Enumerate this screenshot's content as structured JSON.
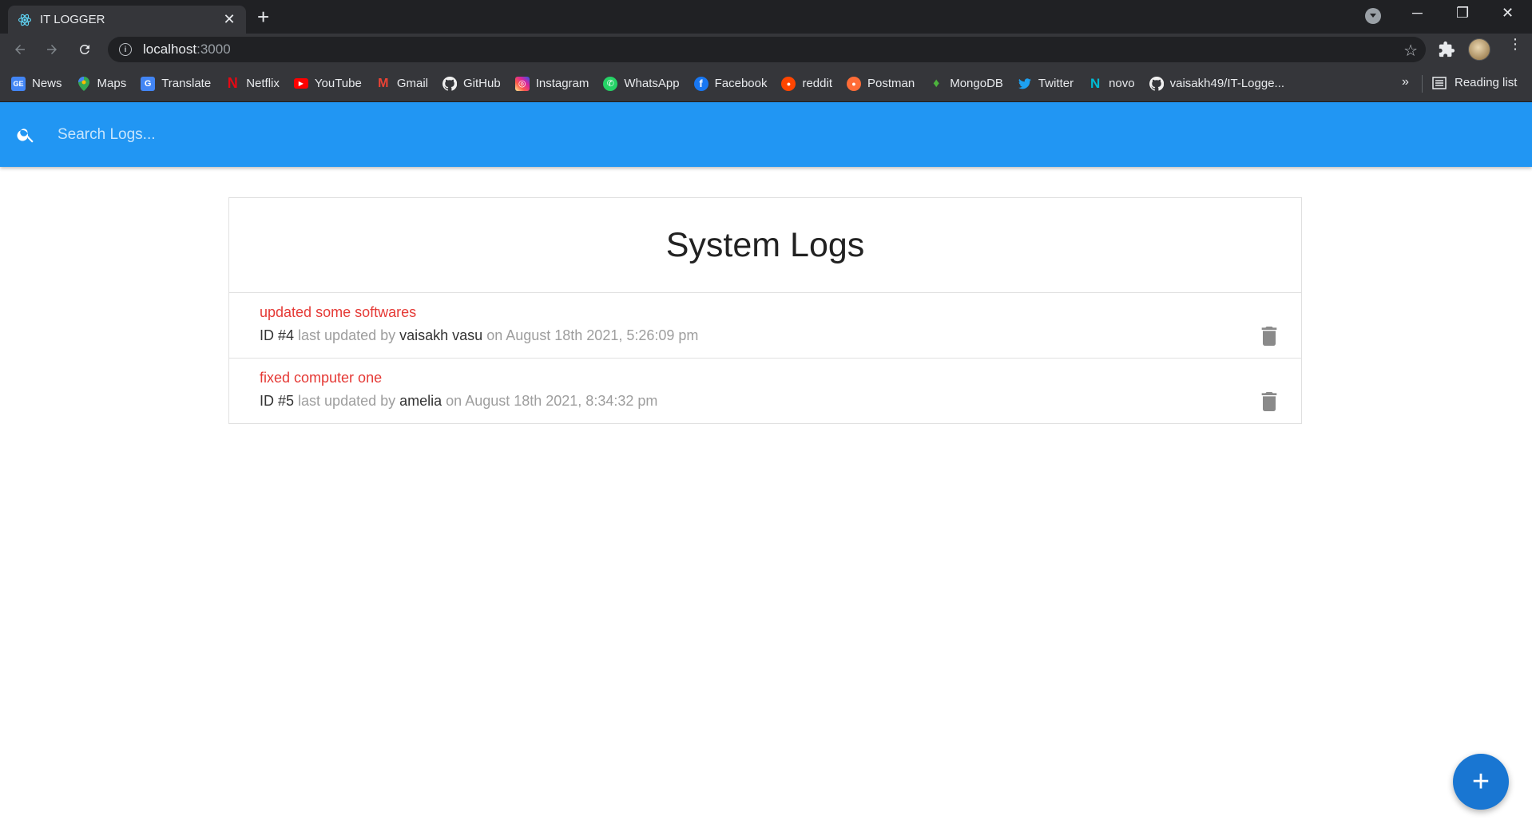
{
  "browser": {
    "tab_title": "IT LOGGER",
    "url_host": "localhost",
    "url_port": ":3000",
    "bookmarks": [
      {
        "label": "News",
        "icon": "google-news-icon",
        "color": "#4285f4",
        "glyph": "GE"
      },
      {
        "label": "Maps",
        "icon": "google-maps-icon",
        "color": "#34a853",
        "glyph": "◉"
      },
      {
        "label": "Translate",
        "icon": "google-translate-icon",
        "color": "#4285f4",
        "glyph": "G"
      },
      {
        "label": "Netflix",
        "icon": "netflix-icon",
        "color": "#e50914",
        "glyph": "N"
      },
      {
        "label": "YouTube",
        "icon": "youtube-icon",
        "color": "#ff0000",
        "glyph": "▶"
      },
      {
        "label": "Gmail",
        "icon": "gmail-icon",
        "color": "#ea4335",
        "glyph": "M"
      },
      {
        "label": "GitHub",
        "icon": "github-icon",
        "color": "#f0f0f0",
        "glyph": "●"
      },
      {
        "label": "Instagram",
        "icon": "instagram-icon",
        "color": "#d6249f",
        "glyph": "◎"
      },
      {
        "label": "WhatsApp",
        "icon": "whatsapp-icon",
        "color": "#25d366",
        "glyph": "✆"
      },
      {
        "label": "Facebook",
        "icon": "facebook-icon",
        "color": "#1877f2",
        "glyph": "f"
      },
      {
        "label": "reddit",
        "icon": "reddit-icon",
        "color": "#ff4500",
        "glyph": "●"
      },
      {
        "label": "Postman",
        "icon": "postman-icon",
        "color": "#ff6c37",
        "glyph": "●"
      },
      {
        "label": "MongoDB",
        "icon": "mongodb-icon",
        "color": "#4db33d",
        "glyph": "♦"
      },
      {
        "label": "Twitter",
        "icon": "twitter-icon",
        "color": "#1da1f2",
        "glyph": "✦"
      },
      {
        "label": "novo",
        "icon": "novo-icon",
        "color": "#00bcd4",
        "glyph": "N"
      },
      {
        "label": "vaisakh49/IT-Logge...",
        "icon": "github-icon",
        "color": "#f0f0f0",
        "glyph": "●"
      }
    ],
    "more_bookmarks": "»",
    "reading_list": "Reading list"
  },
  "search": {
    "placeholder": "Search Logs..."
  },
  "logs_panel": {
    "title": "System Logs",
    "logs": [
      {
        "message": "updated some softwares",
        "id_label": "ID #4",
        "by_text": " last updated by ",
        "tech": "vaisakh vasu",
        "on_text": " on ",
        "date": "August 18th 2021, 5:26:09 pm"
      },
      {
        "message": "fixed computer one",
        "id_label": "ID #5",
        "by_text": " last updated by ",
        "tech": "amelia",
        "on_text": " on ",
        "date": "August 18th 2021, 8:34:32 pm"
      }
    ]
  },
  "fab": {
    "label": "+"
  },
  "colors": {
    "app_bar": "#2196f3",
    "log_message": "#e53935",
    "fab": "#1976d2"
  }
}
